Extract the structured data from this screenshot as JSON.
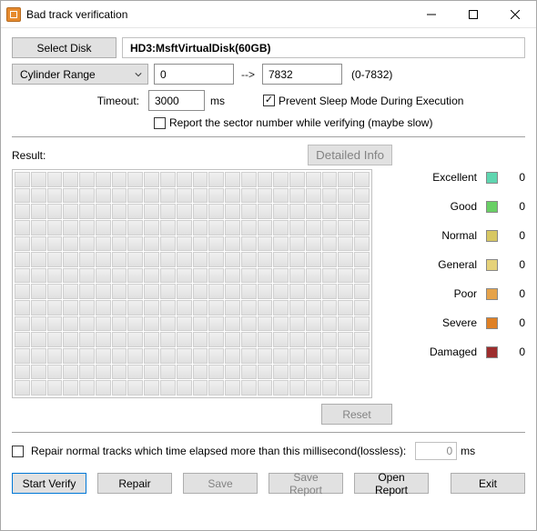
{
  "window": {
    "title": "Bad track verification"
  },
  "top": {
    "select_disk_label": "Select Disk",
    "disk_desc": "HD3:MsftVirtualDisk(60GB)",
    "range_mode": "Cylinder Range",
    "range_from": "0",
    "range_arrow": "-->",
    "range_to": "7832",
    "range_hint": "(0-7832)",
    "timeout_label": "Timeout:",
    "timeout_value": "3000",
    "ms_label": "ms",
    "prevent_sleep_checked": true,
    "prevent_sleep_label": "Prevent Sleep Mode During Execution",
    "report_sector_checked": false,
    "report_sector_label": "Report the sector number while verifying (maybe slow)"
  },
  "result": {
    "label": "Result:",
    "detailed_button": "Detailed Info",
    "reset_button": "Reset",
    "legend": [
      {
        "name": "Excellent",
        "color": "#5fd6b0",
        "count": "0"
      },
      {
        "name": "Good",
        "color": "#69cf65",
        "count": "0"
      },
      {
        "name": "Normal",
        "color": "#d7c763",
        "count": "0"
      },
      {
        "name": "General",
        "color": "#e6d27a",
        "count": "0"
      },
      {
        "name": "Poor",
        "color": "#e6a34a",
        "count": "0"
      },
      {
        "name": "Severe",
        "color": "#df8024",
        "count": "0"
      },
      {
        "name": "Damaged",
        "color": "#9d2d2d",
        "count": "0"
      }
    ]
  },
  "footer": {
    "repair_checked": false,
    "repair_label": "Repair normal tracks which time elapsed more than this millisecond(lossless):",
    "repair_value": "0",
    "repair_ms": "ms",
    "buttons": {
      "start": "Start Verify",
      "repair": "Repair",
      "save": "Save",
      "save_report": "Save Report",
      "open_report": "Open Report",
      "exit": "Exit"
    }
  }
}
